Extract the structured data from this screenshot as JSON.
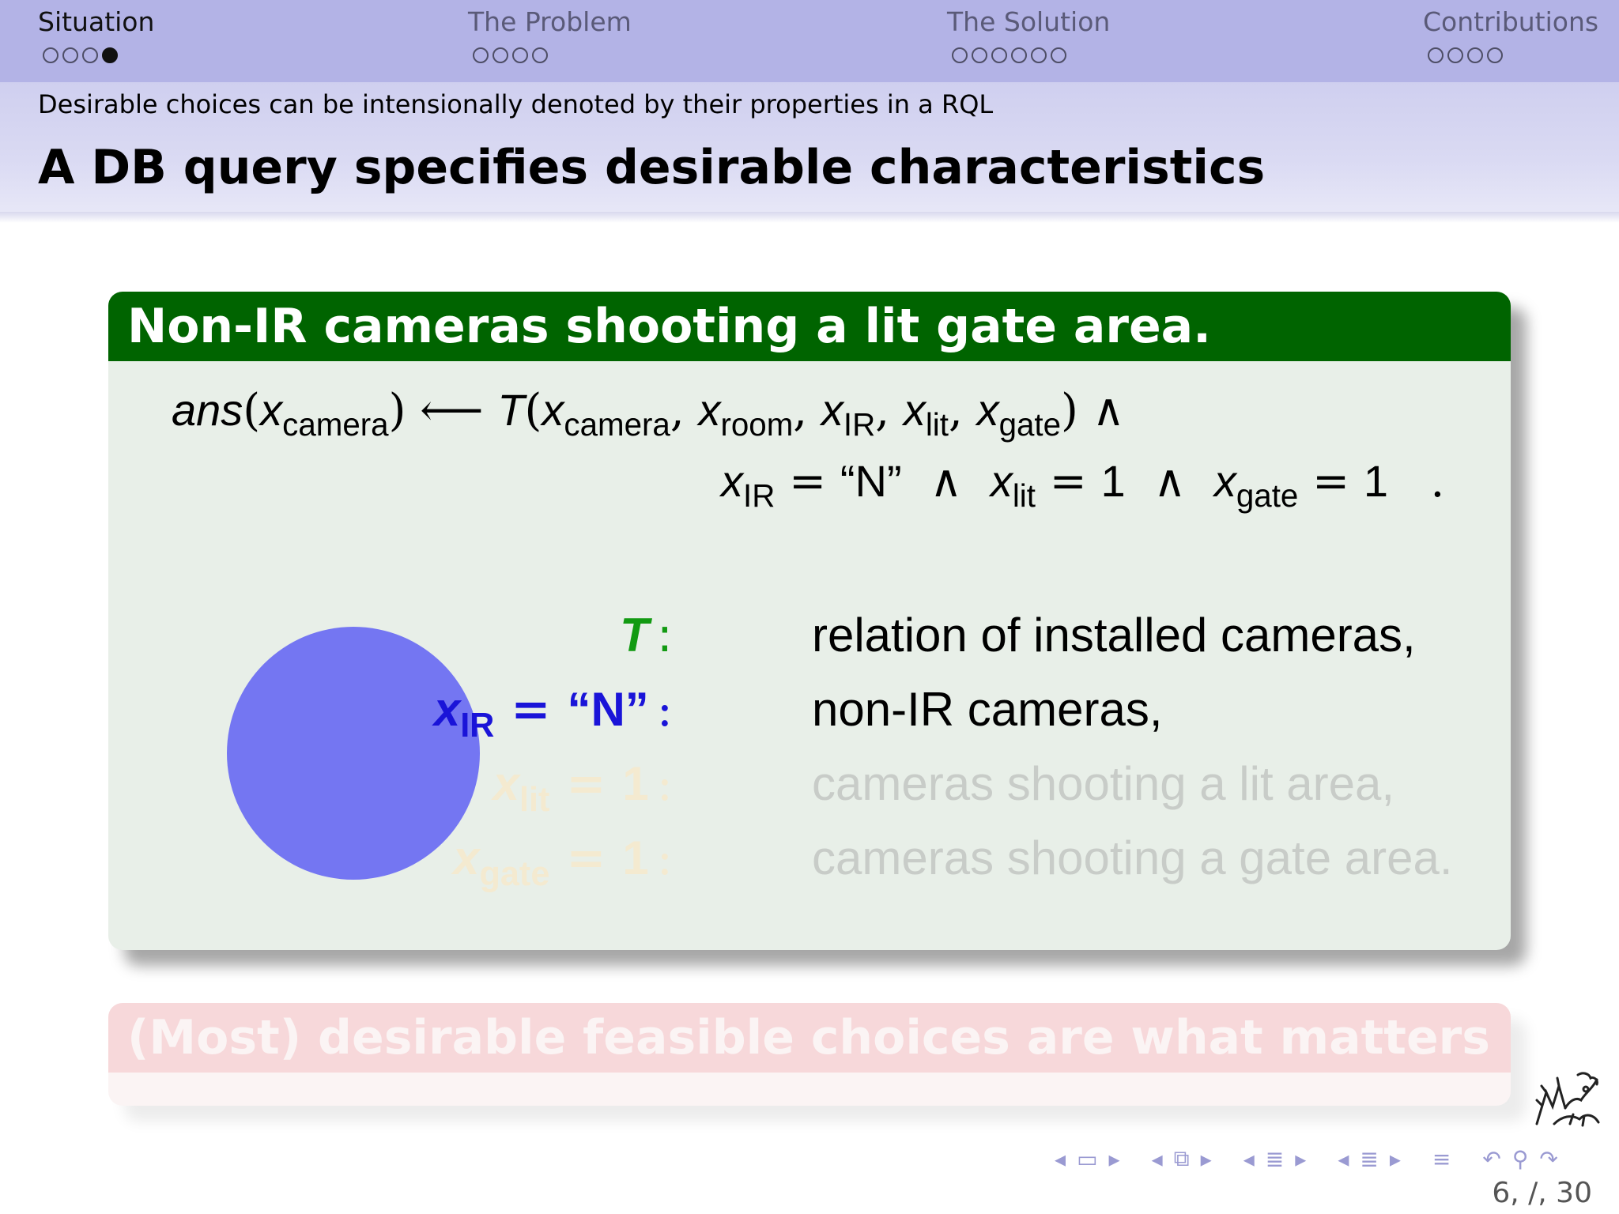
{
  "nav": {
    "sections": [
      {
        "title": "Situation",
        "dots": [
          false,
          false,
          false,
          true
        ],
        "active": true
      },
      {
        "title": "The Problem",
        "dots": [
          false,
          false,
          false,
          false
        ],
        "active": false
      },
      {
        "title": "The Solution",
        "dots": [
          false,
          false,
          false,
          false,
          false,
          false
        ],
        "active": false
      },
      {
        "title": "Contributions",
        "dots": [
          false,
          false,
          false,
          false
        ],
        "active": false
      }
    ]
  },
  "frame": {
    "subtitle": "Desirable choices can be intensionally denoted by their properties in a RQL",
    "title": "A DB query specifies desirable characteristics"
  },
  "example": {
    "title": "Non-IR cameras shooting a lit gate area.",
    "formula": {
      "ans": "ans",
      "T": "T",
      "x": "x",
      "camera": "camera",
      "room": "room",
      "IR": "IR",
      "lit": "lit",
      "gate": "gate",
      "arrow": "⟵",
      "and": "∧",
      "eq": "=",
      "N_quoted": "“N”",
      "one": "1",
      "period": "."
    },
    "definitions": [
      {
        "term": "T",
        "text": "relation of installed cameras,"
      },
      {
        "term_lhs": "x",
        "term_sub": "IR",
        "term_rhs": "“N”",
        "text": "non-IR cameras,"
      },
      {
        "term_lhs": "x",
        "term_sub": "lit",
        "term_rhs": "1",
        "text": "cameras shooting a lit area,"
      },
      {
        "term_lhs": "x",
        "term_sub": "gate",
        "term_rhs": "1",
        "text": "cameras shooting a gate area."
      }
    ],
    "colors": {
      "header": "#006400",
      "body": "#e8efe8",
      "term_T": "#129a12",
      "term_IR": "#1a14d8",
      "circle": "#7476f2"
    }
  },
  "alert": {
    "title": "(Most) desirable feasible choices are what matters (most)!"
  },
  "controls": {
    "icons": [
      "arrow-left-icon",
      "frame-icon",
      "arrow-right-icon",
      "arrow-left-icon",
      "slides-icon",
      "arrow-right-icon",
      "arrow-left-icon",
      "subsection-icon",
      "arrow-right-icon",
      "arrow-left-icon",
      "section-icon",
      "arrow-right-icon",
      "toc-icon",
      "back-icon",
      "search-icon",
      "forward-icon"
    ]
  },
  "page_number": "6, /, 30"
}
